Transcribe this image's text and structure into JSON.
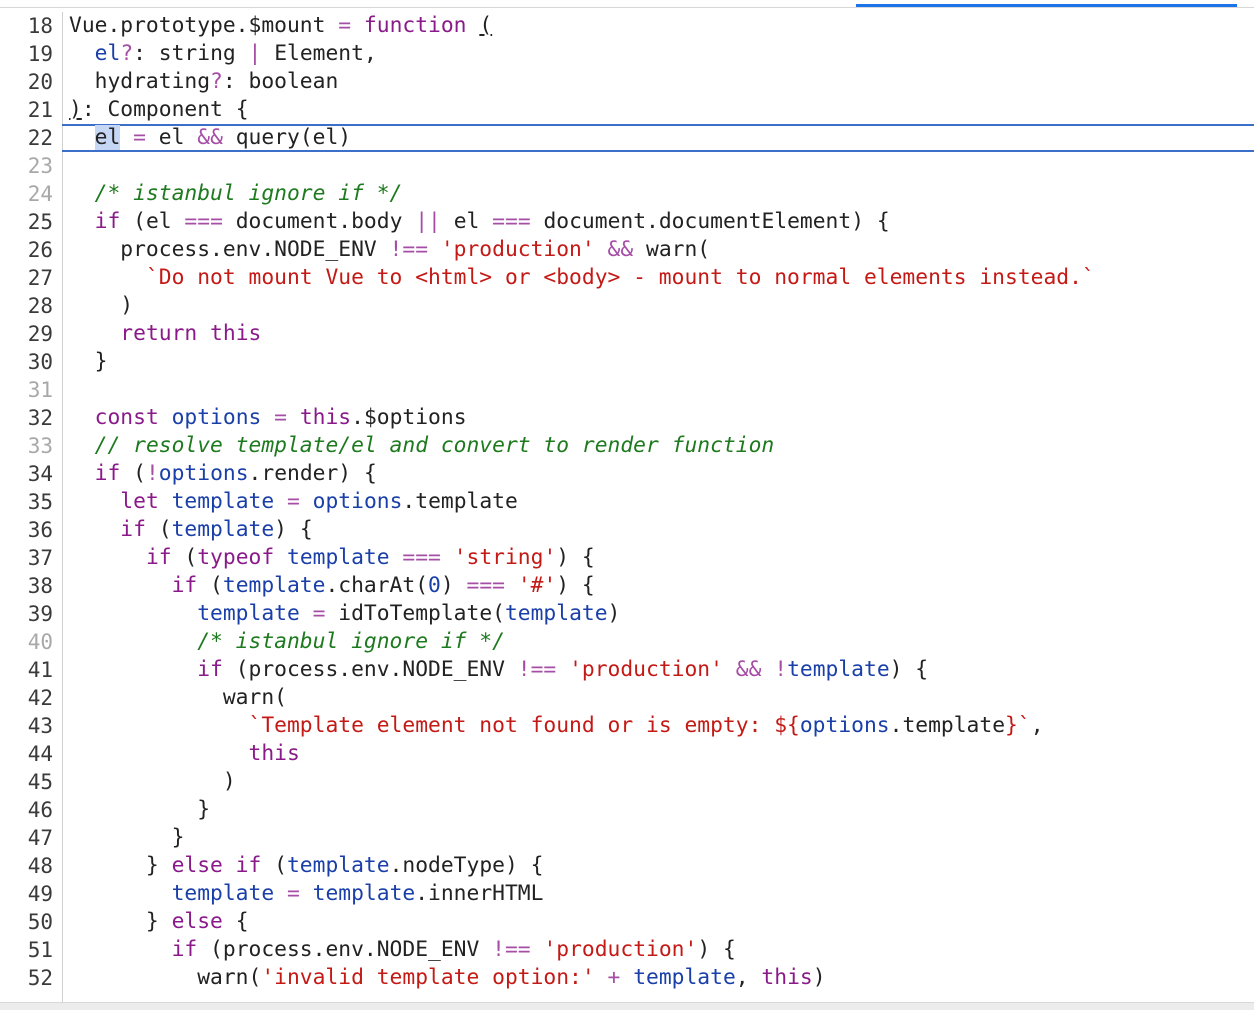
{
  "editor": {
    "language": "javascript",
    "highlighted_line": 22,
    "lines": [
      {
        "n": "18",
        "dim": false,
        "tokens": [
          [
            "t",
            "Vue.prototype.$mount "
          ],
          [
            "op",
            "= "
          ],
          [
            "kw",
            "function "
          ],
          [
            "u",
            "("
          ]
        ]
      },
      {
        "n": "19",
        "dim": false,
        "tokens": [
          [
            "t",
            "  "
          ],
          [
            "var",
            "el"
          ],
          [
            "op",
            "?"
          ],
          [
            "t",
            ": string "
          ],
          [
            "op",
            "| "
          ],
          [
            "t",
            "Element,"
          ]
        ]
      },
      {
        "n": "20",
        "dim": false,
        "tokens": [
          [
            "t",
            "  hydrating"
          ],
          [
            "op",
            "?"
          ],
          [
            "t",
            ": boolean"
          ]
        ]
      },
      {
        "n": "21",
        "dim": false,
        "tokens": [
          [
            "u",
            ")"
          ],
          [
            "t",
            ": Component {"
          ]
        ]
      },
      {
        "n": "22",
        "dim": false,
        "tokens": [
          [
            "t",
            "  "
          ],
          [
            "sel",
            "el"
          ],
          [
            "t",
            " "
          ],
          [
            "op",
            "= "
          ],
          [
            "t",
            "el "
          ],
          [
            "op",
            "&& "
          ],
          [
            "t",
            "query(el)"
          ]
        ]
      },
      {
        "n": "23",
        "dim": true,
        "tokens": []
      },
      {
        "n": "24",
        "dim": true,
        "tokens": [
          [
            "t",
            "  "
          ],
          [
            "cm",
            "/* istanbul ignore if */"
          ]
        ]
      },
      {
        "n": "25",
        "dim": false,
        "tokens": [
          [
            "t",
            "  "
          ],
          [
            "kw",
            "if "
          ],
          [
            "t",
            "(el "
          ],
          [
            "op",
            "=== "
          ],
          [
            "t",
            "document.body "
          ],
          [
            "op",
            "|| "
          ],
          [
            "t",
            "el "
          ],
          [
            "op",
            "=== "
          ],
          [
            "t",
            "document.documentElement) {"
          ]
        ]
      },
      {
        "n": "26",
        "dim": false,
        "tokens": [
          [
            "t",
            "    process.env.NODE_ENV "
          ],
          [
            "op",
            "!== "
          ],
          [
            "str",
            "'production'"
          ],
          [
            "t",
            " "
          ],
          [
            "op",
            "&& "
          ],
          [
            "t",
            "warn("
          ]
        ]
      },
      {
        "n": "27",
        "dim": false,
        "tokens": [
          [
            "t",
            "      "
          ],
          [
            "str",
            "`Do not mount Vue to <html> or <body> - mount to normal elements instead.`"
          ]
        ]
      },
      {
        "n": "28",
        "dim": false,
        "tokens": [
          [
            "t",
            "    )"
          ]
        ]
      },
      {
        "n": "29",
        "dim": false,
        "tokens": [
          [
            "t",
            "    "
          ],
          [
            "kw",
            "return this"
          ]
        ]
      },
      {
        "n": "30",
        "dim": false,
        "tokens": [
          [
            "t",
            "  }"
          ]
        ]
      },
      {
        "n": "31",
        "dim": true,
        "tokens": []
      },
      {
        "n": "32",
        "dim": false,
        "tokens": [
          [
            "t",
            "  "
          ],
          [
            "kw",
            "const "
          ],
          [
            "var",
            "options "
          ],
          [
            "op",
            "= "
          ],
          [
            "kw",
            "this"
          ],
          [
            "t",
            ".$options"
          ]
        ]
      },
      {
        "n": "33",
        "dim": true,
        "tokens": [
          [
            "t",
            "  "
          ],
          [
            "cm",
            "// resolve template/el and convert to render function"
          ]
        ]
      },
      {
        "n": "34",
        "dim": false,
        "tokens": [
          [
            "t",
            "  "
          ],
          [
            "kw",
            "if "
          ],
          [
            "t",
            "("
          ],
          [
            "op",
            "!"
          ],
          [
            "var",
            "options"
          ],
          [
            "t",
            ".render) {"
          ]
        ]
      },
      {
        "n": "35",
        "dim": false,
        "tokens": [
          [
            "t",
            "    "
          ],
          [
            "kw",
            "let "
          ],
          [
            "var",
            "template "
          ],
          [
            "op",
            "= "
          ],
          [
            "var",
            "options"
          ],
          [
            "t",
            ".template"
          ]
        ]
      },
      {
        "n": "36",
        "dim": false,
        "tokens": [
          [
            "t",
            "    "
          ],
          [
            "kw",
            "if "
          ],
          [
            "t",
            "("
          ],
          [
            "var",
            "template"
          ],
          [
            "t",
            ") {"
          ]
        ]
      },
      {
        "n": "37",
        "dim": false,
        "tokens": [
          [
            "t",
            "      "
          ],
          [
            "kw",
            "if "
          ],
          [
            "t",
            "("
          ],
          [
            "kw",
            "typeof "
          ],
          [
            "var",
            "template "
          ],
          [
            "op",
            "=== "
          ],
          [
            "str",
            "'string'"
          ],
          [
            "t",
            ") {"
          ]
        ]
      },
      {
        "n": "38",
        "dim": false,
        "tokens": [
          [
            "t",
            "        "
          ],
          [
            "kw",
            "if "
          ],
          [
            "t",
            "("
          ],
          [
            "var",
            "template"
          ],
          [
            "t",
            ".charAt("
          ],
          [
            "var",
            "0"
          ],
          [
            "t",
            ") "
          ],
          [
            "op",
            "=== "
          ],
          [
            "str",
            "'#'"
          ],
          [
            "t",
            ") {"
          ]
        ]
      },
      {
        "n": "39",
        "dim": false,
        "tokens": [
          [
            "t",
            "          "
          ],
          [
            "var",
            "template "
          ],
          [
            "op",
            "= "
          ],
          [
            "t",
            "idToTemplate("
          ],
          [
            "var",
            "template"
          ],
          [
            "t",
            ")"
          ]
        ]
      },
      {
        "n": "40",
        "dim": true,
        "tokens": [
          [
            "t",
            "          "
          ],
          [
            "cm",
            "/* istanbul ignore if */"
          ]
        ]
      },
      {
        "n": "41",
        "dim": false,
        "tokens": [
          [
            "t",
            "          "
          ],
          [
            "kw",
            "if "
          ],
          [
            "t",
            "(process.env.NODE_ENV "
          ],
          [
            "op",
            "!== "
          ],
          [
            "str",
            "'production'"
          ],
          [
            "t",
            " "
          ],
          [
            "op",
            "&& !"
          ],
          [
            "var",
            "template"
          ],
          [
            "t",
            ") {"
          ]
        ]
      },
      {
        "n": "42",
        "dim": false,
        "tokens": [
          [
            "t",
            "            warn("
          ]
        ]
      },
      {
        "n": "43",
        "dim": false,
        "tokens": [
          [
            "t",
            "              "
          ],
          [
            "str",
            "`Template element not found or is empty: ${"
          ],
          [
            "var",
            "options"
          ],
          [
            "t",
            ".template"
          ],
          [
            "str",
            "}`"
          ],
          [
            "t",
            ","
          ]
        ]
      },
      {
        "n": "44",
        "dim": false,
        "tokens": [
          [
            "t",
            "              "
          ],
          [
            "kw",
            "this"
          ]
        ]
      },
      {
        "n": "45",
        "dim": false,
        "tokens": [
          [
            "t",
            "            )"
          ]
        ]
      },
      {
        "n": "46",
        "dim": false,
        "tokens": [
          [
            "t",
            "          }"
          ]
        ]
      },
      {
        "n": "47",
        "dim": false,
        "tokens": [
          [
            "t",
            "        }"
          ]
        ]
      },
      {
        "n": "48",
        "dim": false,
        "tokens": [
          [
            "t",
            "      } "
          ],
          [
            "kw",
            "else if "
          ],
          [
            "t",
            "("
          ],
          [
            "var",
            "template"
          ],
          [
            "t",
            ".nodeType) {"
          ]
        ]
      },
      {
        "n": "49",
        "dim": false,
        "tokens": [
          [
            "t",
            "        "
          ],
          [
            "var",
            "template "
          ],
          [
            "op",
            "= "
          ],
          [
            "var",
            "template"
          ],
          [
            "t",
            ".innerHTML"
          ]
        ]
      },
      {
        "n": "50",
        "dim": false,
        "tokens": [
          [
            "t",
            "      } "
          ],
          [
            "kw",
            "else "
          ],
          [
            "t",
            "{"
          ]
        ]
      },
      {
        "n": "51",
        "dim": false,
        "tokens": [
          [
            "t",
            "        "
          ],
          [
            "kw",
            "if "
          ],
          [
            "t",
            "(process.env.NODE_ENV "
          ],
          [
            "op",
            "!== "
          ],
          [
            "str",
            "'production'"
          ],
          [
            "t",
            ") {"
          ]
        ]
      },
      {
        "n": "52",
        "dim": false,
        "tokens": [
          [
            "t",
            "          warn("
          ],
          [
            "str",
            "'invalid template option:'"
          ],
          [
            "t",
            " "
          ],
          [
            "op",
            "+ "
          ],
          [
            "var",
            "template"
          ],
          [
            "t",
            ", "
          ],
          [
            "kw",
            "this"
          ],
          [
            "t",
            ")"
          ]
        ]
      }
    ]
  }
}
